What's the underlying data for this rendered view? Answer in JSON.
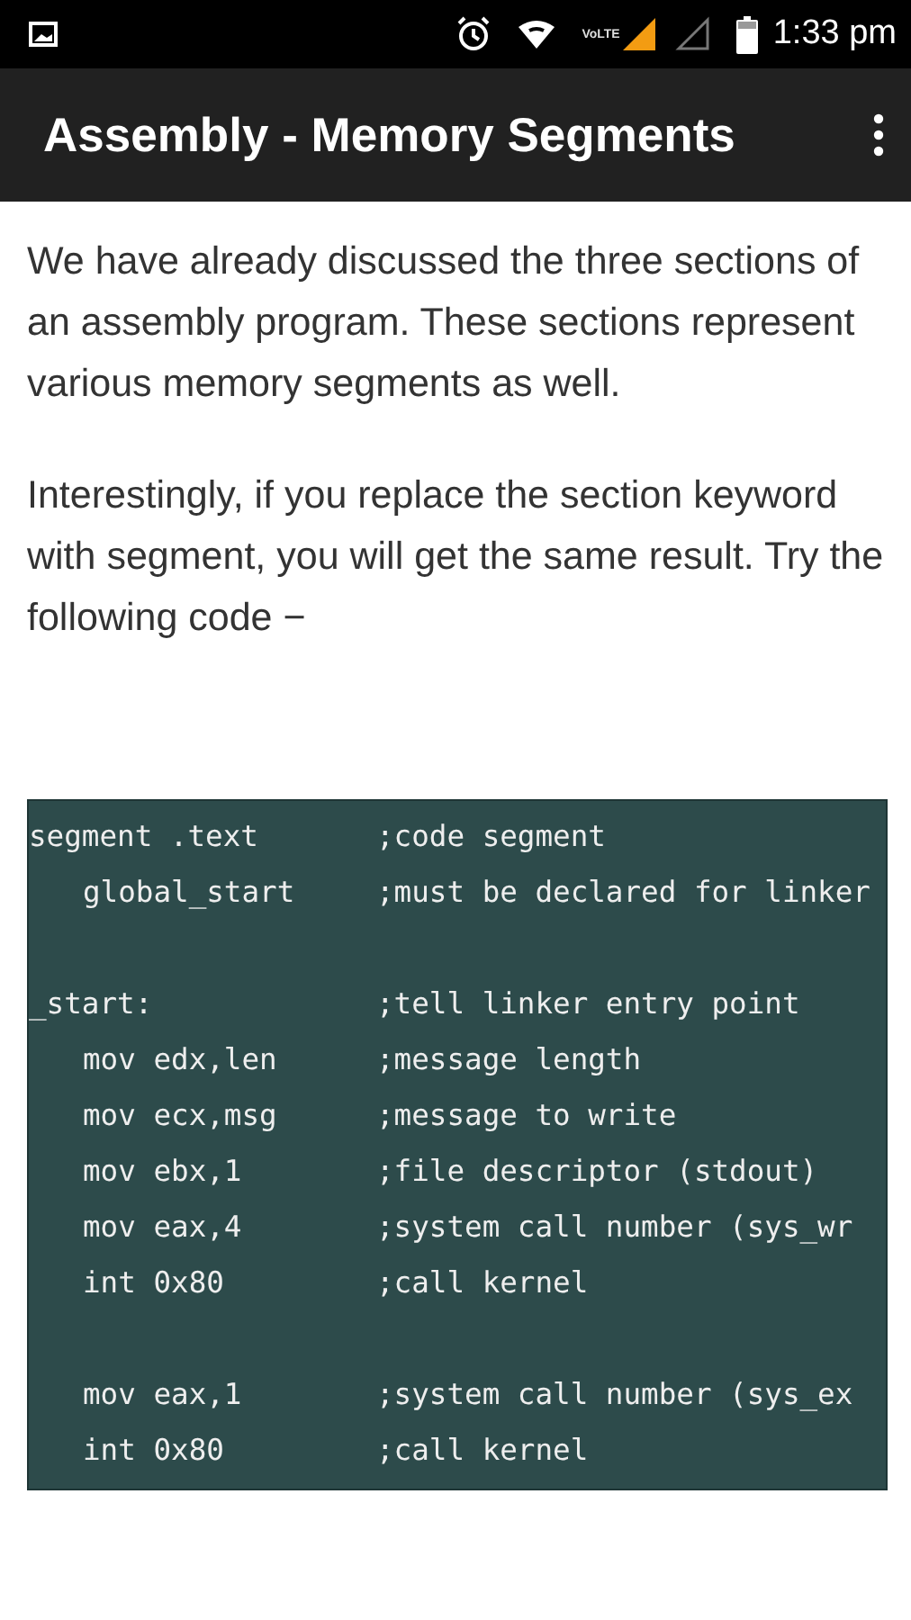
{
  "status_bar": {
    "time": "1:33 pm",
    "network": "VoLTE"
  },
  "app_bar": {
    "title": "Assembly - Memory Segments"
  },
  "paragraphs": [
    "We have already discussed the three sections of an assembly program. These sections represent various memory segments as well.",
    "Interestingly, if you replace the section keyword with segment, you will get the same result. Try the following code −"
  ],
  "code_lines": [
    {
      "code": "segment .text",
      "comment": ";code segment",
      "indented": false,
      "gap_before": false
    },
    {
      "code": "global_start",
      "comment": ";must be declared for linker",
      "indented": true,
      "gap_before": false
    },
    {
      "code": "_start:",
      "comment": ";tell linker entry point",
      "indented": false,
      "gap_before": true
    },
    {
      "code": "mov edx,len",
      "comment": ";message length",
      "indented": true,
      "gap_before": false
    },
    {
      "code": "mov ecx,msg",
      "comment": ";message to write",
      "indented": true,
      "gap_before": false
    },
    {
      "code": "mov ebx,1",
      "comment": ";file descriptor (stdout)",
      "indented": true,
      "gap_before": false
    },
    {
      "code": "mov eax,4",
      "comment": ";system call number (sys_wr",
      "indented": true,
      "gap_before": false
    },
    {
      "code": "int 0x80",
      "comment": ";call kernel",
      "indented": true,
      "gap_before": false
    },
    {
      "code": "mov eax,1",
      "comment": ";system call number (sys_ex",
      "indented": true,
      "gap_before": true
    },
    {
      "code": "int 0x80",
      "comment": ";call kernel",
      "indented": true,
      "gap_before": false
    }
  ]
}
